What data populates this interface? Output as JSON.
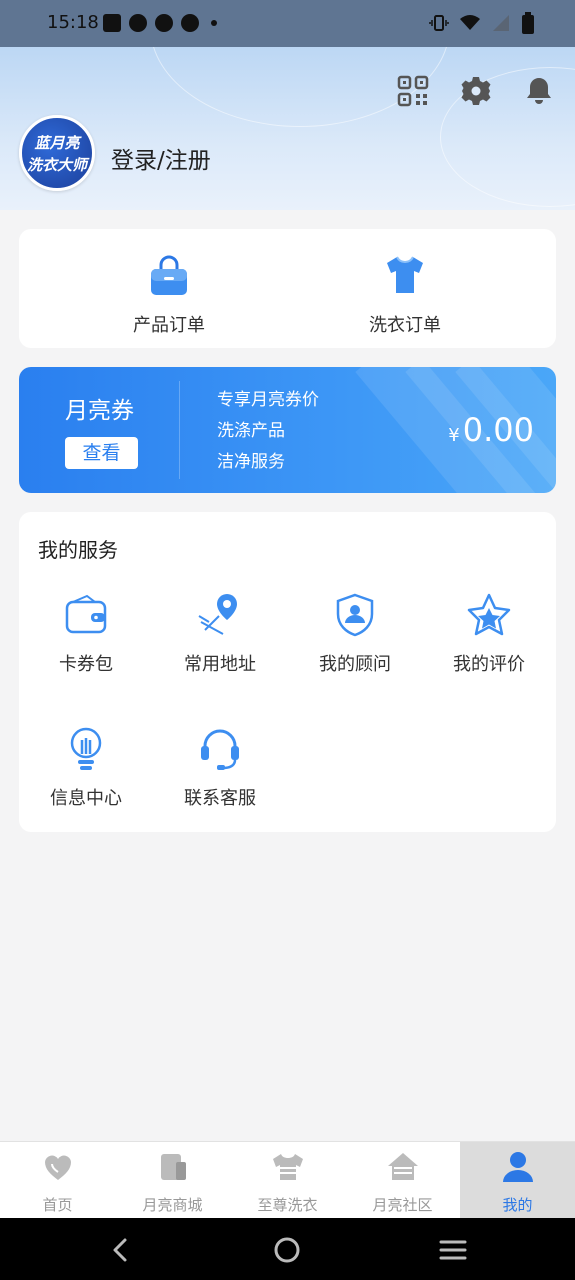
{
  "status_bar": {
    "time": "15:18",
    "left_icons": [
      "mail-icon",
      "app-icon",
      "app-icon",
      "app-icon"
    ],
    "right_icons": [
      "vibrate-icon",
      "wifi-icon",
      "signal-icon",
      "battery-icon"
    ]
  },
  "header": {
    "avatar_line1": "蓝月亮",
    "avatar_line2": "洗衣大师",
    "login_label": "登录/注册",
    "icons": [
      "qr-code-icon",
      "gear-icon",
      "bell-icon"
    ]
  },
  "orders": [
    {
      "label": "产品订单",
      "icon": "shopping-bag-icon"
    },
    {
      "label": "洗衣订单",
      "icon": "tshirt-icon"
    }
  ],
  "coupon": {
    "title": "月亮券",
    "button_label": "查看",
    "lines": [
      "专享月亮券价",
      "洗涤产品",
      "洁净服务"
    ],
    "currency": "¥",
    "amount": "0.00"
  },
  "services": {
    "title": "我的服务",
    "items": [
      {
        "label": "卡券包",
        "icon": "wallet-icon"
      },
      {
        "label": "常用地址",
        "icon": "location-pin-icon"
      },
      {
        "label": "我的顾问",
        "icon": "advisor-shield-icon"
      },
      {
        "label": "我的评价",
        "icon": "star-icon"
      },
      {
        "label": "信息中心",
        "icon": "lightbulb-icon"
      },
      {
        "label": "联系客服",
        "icon": "headset-icon"
      }
    ]
  },
  "tabs": [
    {
      "label": "首页",
      "icon": "home-heart-icon",
      "active": false
    },
    {
      "label": "月亮商城",
      "icon": "shop-icon",
      "active": false
    },
    {
      "label": "至尊洗衣",
      "icon": "shirt-icon",
      "active": false
    },
    {
      "label": "月亮社区",
      "icon": "house-icon",
      "active": false
    },
    {
      "label": "我的",
      "icon": "user-icon",
      "active": true
    }
  ],
  "colors": {
    "accent": "#2c78e5",
    "coupon_start": "#2a7fef",
    "coupon_end": "#4aa7f8",
    "header_top": "#bcd7f4",
    "status_bar": "#5f7592"
  }
}
